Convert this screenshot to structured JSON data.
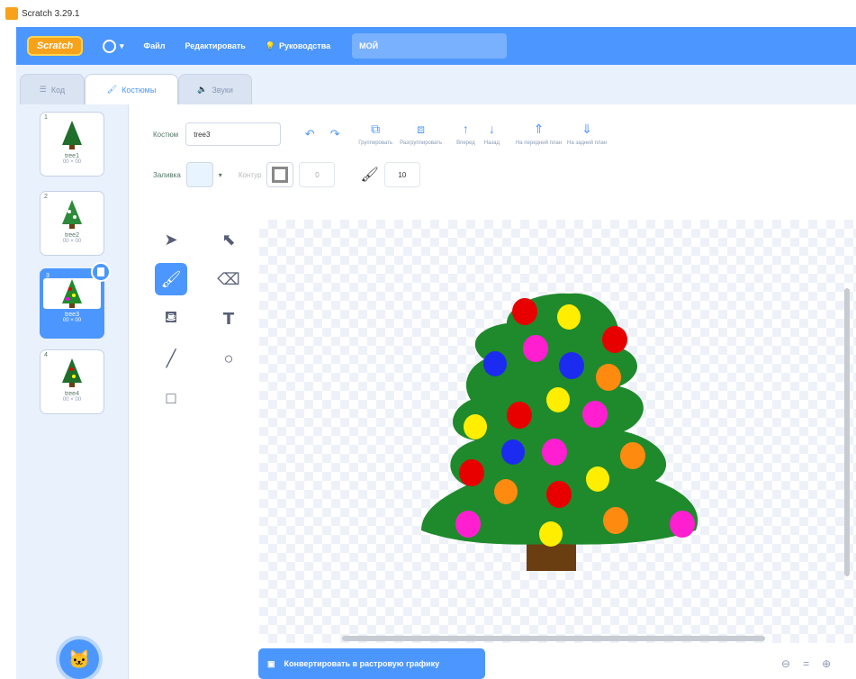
{
  "window": {
    "title": "Scratch 3.29.1"
  },
  "menubar": {
    "logo": "Scratch",
    "file": "Файл",
    "edit": "Редактировать",
    "tutorials": "Руководства",
    "project_title": "МОЙ"
  },
  "tabs": [
    {
      "label": "Код"
    },
    {
      "label": "Костюмы"
    },
    {
      "label": "Звуки"
    }
  ],
  "costumes": [
    {
      "num": "1",
      "name": "tree1",
      "size": "00 × 00"
    },
    {
      "num": "2",
      "name": "tree2",
      "size": "00 × 00"
    },
    {
      "num": "3",
      "name": "tree3",
      "size": "00 × 00"
    },
    {
      "num": "4",
      "name": "tree4",
      "size": "00 × 00"
    }
  ],
  "editor": {
    "costume_label": "Костюм",
    "costume_name": "tree3",
    "group": "Группировать",
    "ungroup": "Разгруппировать",
    "forward": "Вперед",
    "backward": "Назад",
    "front": "На передний план",
    "back": "На задний план",
    "fill_label": "Заливка",
    "outline_label": "Контур",
    "outline_width": "0",
    "brush_size": "10",
    "convert_button": "Конвертировать в растровую графику"
  },
  "colors": {
    "accent": "#4c97ff",
    "tree": "#1f8a2c",
    "trunk": "#6b3e12"
  }
}
